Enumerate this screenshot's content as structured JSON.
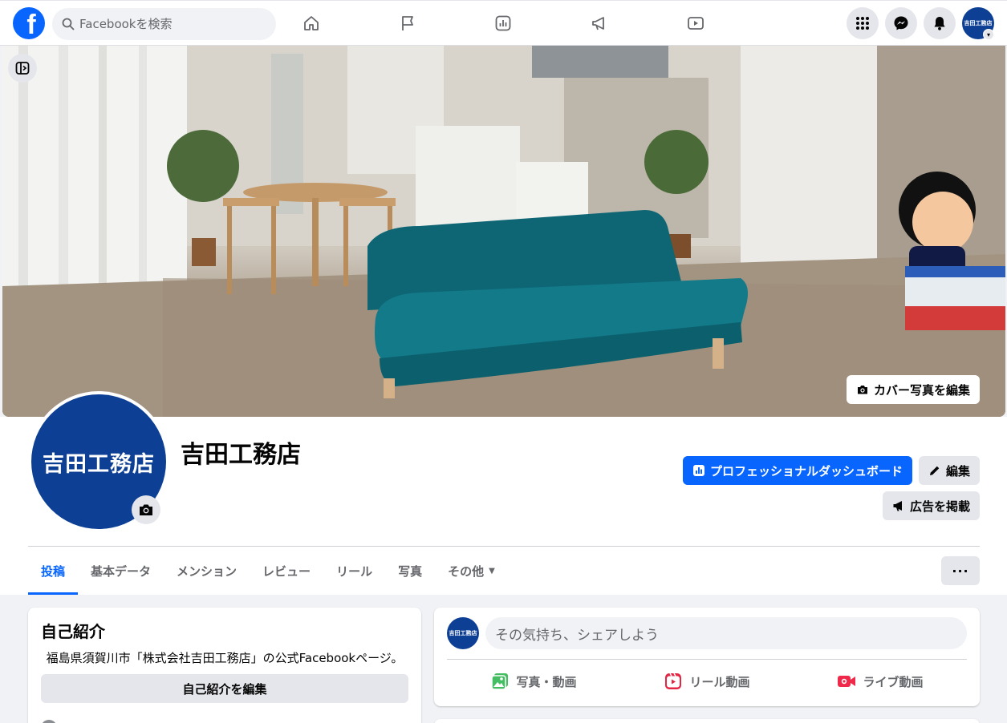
{
  "topnav": {
    "logo": "f",
    "search_placeholder": "Facebookを検索",
    "nav_icons": [
      "home-icon",
      "flag-icon",
      "insights-icon",
      "megaphone-icon",
      "video-icon"
    ],
    "right_icons": [
      "menu-grid-icon",
      "messenger-icon",
      "bell-icon"
    ],
    "account_avatar_text": "吉田工務店"
  },
  "cover": {
    "edit_label": "カバー写真を編集"
  },
  "profile": {
    "name": "吉田工務店",
    "avatar_text": "吉田工務店",
    "dashboard_label": "プロフェッショナルダッシュボード",
    "edit_label": "編集",
    "ad_label": "広告を掲載"
  },
  "tabs": {
    "items": [
      {
        "label": "投稿"
      },
      {
        "label": "基本データ"
      },
      {
        "label": "メンション"
      },
      {
        "label": "レビュー"
      },
      {
        "label": "リール"
      },
      {
        "label": "写真"
      },
      {
        "label": "その他"
      }
    ],
    "active_index": 0,
    "more_label": "···"
  },
  "intro": {
    "title": "自己紹介",
    "bio": "福島県須賀川市「株式会社吉田工務店」の公式Facebookページ。",
    "edit_label": "自己紹介を編集"
  },
  "composer": {
    "avatar_text": "吉田工務店",
    "prompt": "その気持ち、シェアしよう",
    "actions": [
      {
        "label": "写真・動画",
        "icon": "photo-icon"
      },
      {
        "label": "リール動画",
        "icon": "reel-icon"
      },
      {
        "label": "ライブ動画",
        "icon": "live-video-icon"
      }
    ]
  },
  "colors": {
    "accent": "#0866ff",
    "brand_navy": "#0d3f95",
    "photo_green": "#45bd62",
    "reel_pink": "#e42645",
    "live_red": "#f02849"
  }
}
